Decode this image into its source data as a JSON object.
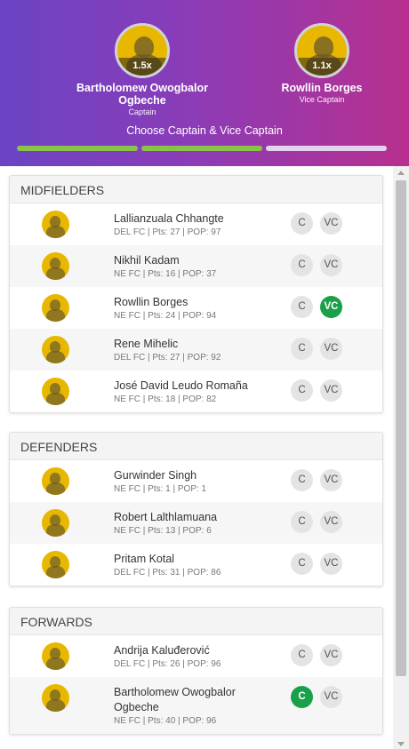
{
  "header": {
    "captain": {
      "name": "Bartholomew Owogbalor Ogbeche",
      "role": "Captain",
      "multiplier": "1.5x"
    },
    "vice_captain": {
      "name": "Rowllin Borges",
      "role": "Vice Captain",
      "multiplier": "1.1x"
    },
    "title": "Choose Captain & Vice Captain",
    "progress": {
      "completed_segments": 2,
      "total_segments": 3
    }
  },
  "colors": {
    "header_gradient_start": "#6a44c4",
    "header_gradient_end": "#b8308f",
    "progress_done": "#8bc34a",
    "selected_button": "#1a9f4a"
  },
  "sections": [
    {
      "title": "MIDFIELDERS",
      "players": [
        {
          "name": "Lallianzuala Chhangte",
          "meta": "DEL FC | Pts: 27 | POP: 97",
          "c_label": "C",
          "vc_label": "VC",
          "is_captain": false,
          "is_vice": false
        },
        {
          "name": "Nikhil Kadam",
          "meta": "NE FC | Pts: 16 | POP: 37",
          "c_label": "C",
          "vc_label": "VC",
          "is_captain": false,
          "is_vice": false
        },
        {
          "name": "Rowllin Borges",
          "meta": "NE FC | Pts: 24 | POP: 94",
          "c_label": "C",
          "vc_label": "VC",
          "is_captain": false,
          "is_vice": true
        },
        {
          "name": "Rene Mihelic",
          "meta": "DEL FC | Pts: 27 | POP: 92",
          "c_label": "C",
          "vc_label": "VC",
          "is_captain": false,
          "is_vice": false
        },
        {
          "name": "José David Leudo Romaña",
          "meta": "NE FC | Pts: 18 | POP: 82",
          "c_label": "C",
          "vc_label": "VC",
          "is_captain": false,
          "is_vice": false
        }
      ]
    },
    {
      "title": "DEFENDERS",
      "players": [
        {
          "name": "Gurwinder Singh",
          "meta": "NE FC | Pts: 1 | POP: 1",
          "c_label": "C",
          "vc_label": "VC",
          "is_captain": false,
          "is_vice": false
        },
        {
          "name": "Robert Lalthlamuana",
          "meta": "NE FC | Pts: 13 | POP: 6",
          "c_label": "C",
          "vc_label": "VC",
          "is_captain": false,
          "is_vice": false
        },
        {
          "name": "Pritam Kotal",
          "meta": "DEL FC | Pts: 31 | POP: 86",
          "c_label": "C",
          "vc_label": "VC",
          "is_captain": false,
          "is_vice": false
        }
      ]
    },
    {
      "title": "FORWARDS",
      "players": [
        {
          "name": "Andrija Kaluđerović",
          "meta": "DEL FC | Pts: 26 | POP: 96",
          "c_label": "C",
          "vc_label": "VC",
          "is_captain": false,
          "is_vice": false
        },
        {
          "name": "Bartholomew Owogbalor Ogbeche",
          "meta": "NE FC | Pts: 40 | POP: 96",
          "c_label": "C",
          "vc_label": "VC",
          "is_captain": true,
          "is_vice": false
        }
      ]
    }
  ]
}
